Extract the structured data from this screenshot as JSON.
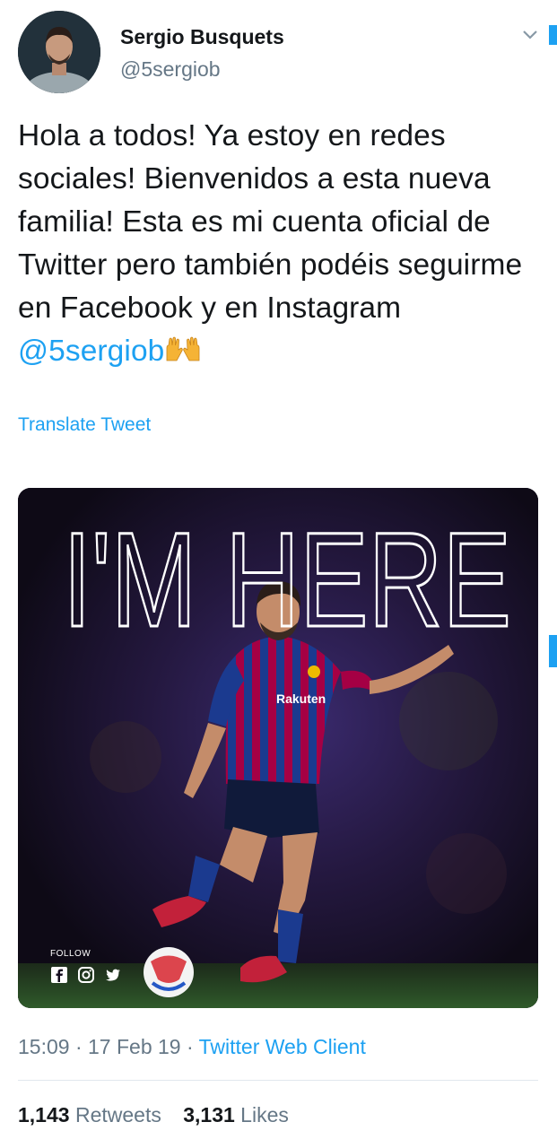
{
  "user": {
    "name": "Sergio Busquets",
    "handle": "@5sergiob"
  },
  "tweet": {
    "text": "Hola a todos! Ya estoy en redes sociales! Bienvenidos a esta nueva familia! Esta es mi cuenta oficial de Twitter pero también podéis seguirme en Facebook y en Instagram ",
    "mention": "@5sergiob",
    "emoji": "raising-hands-emoji"
  },
  "translate_label": "Translate Tweet",
  "media": {
    "headline": "I'M HERE",
    "jersey_sponsor": "Rakuten",
    "follow_label": "FOLLOW",
    "social_icons": [
      "facebook-icon",
      "instagram-icon",
      "twitter-icon"
    ]
  },
  "meta": {
    "time": "15:09",
    "sep1": " · ",
    "date": "17 Feb 19",
    "sep2": " · ",
    "client": "Twitter Web Client"
  },
  "stats": {
    "retweets_count": "1,143",
    "retweets_label": "Retweets",
    "likes_count": "3,131",
    "likes_label": "Likes"
  },
  "colors": {
    "accent": "#1da1f2",
    "secondary_text": "#657786",
    "primary_text": "#14171a",
    "barca_blue": "#1b3a8f",
    "barca_red": "#a50044"
  }
}
